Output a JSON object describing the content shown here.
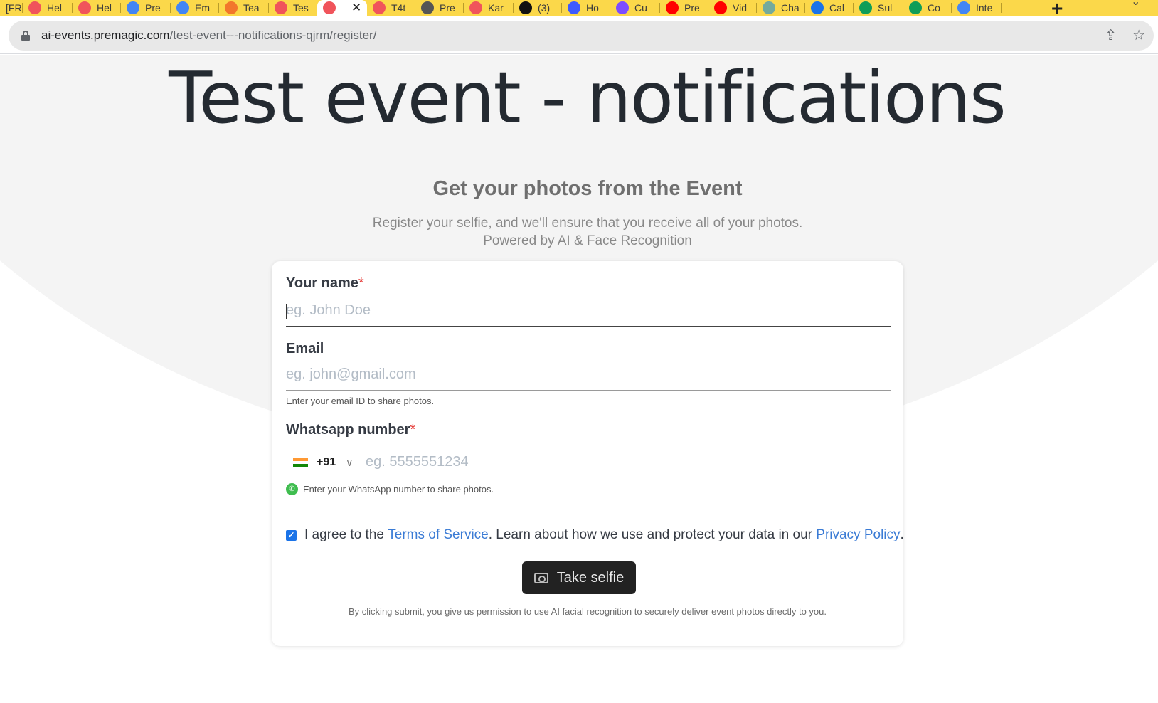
{
  "browser": {
    "tabs": [
      {
        "label": "[FR",
        "favicon": "generic",
        "color": "#fbd84a"
      },
      {
        "label": "Hel",
        "favicon": "premagic-icon",
        "color": "#f0545b"
      },
      {
        "label": "Hel",
        "favicon": "premagic-icon",
        "color": "#f0545b"
      },
      {
        "label": "Pre",
        "favicon": "calendar-icon",
        "color": "#4285f4"
      },
      {
        "label": "Em",
        "favicon": "docs-icon",
        "color": "#4285f4"
      },
      {
        "label": "Tea",
        "favicon": "orange-circle-icon",
        "color": "#f2772c"
      },
      {
        "label": "Tes",
        "favicon": "premagic-icon",
        "color": "#f0545b"
      },
      {
        "label": "",
        "favicon": "premagic-icon",
        "color": "#f0545b",
        "active": true
      },
      {
        "label": "T4t",
        "favicon": "premagic-icon",
        "color": "#f0545b"
      },
      {
        "label": "Pre",
        "favicon": "globe-icon",
        "color": "#555555"
      },
      {
        "label": "Kar",
        "favicon": "premagic-icon",
        "color": "#f0545b"
      },
      {
        "label": "(3)",
        "favicon": "notion-icon",
        "color": "#111111"
      },
      {
        "label": "Ho",
        "favicon": "c-icon",
        "color": "#3d5afe"
      },
      {
        "label": "Cu",
        "favicon": "flower-icon",
        "color": "#7c4dff"
      },
      {
        "label": "Pre",
        "favicon": "youtube-icon",
        "color": "#ff0000"
      },
      {
        "label": "Vid",
        "favicon": "youtube-icon",
        "color": "#ff0000"
      },
      {
        "label": "Cha",
        "favicon": "chatgpt-icon",
        "color": "#74aa9c"
      },
      {
        "label": "Cal",
        "favicon": "o-icon",
        "color": "#1a73e8"
      },
      {
        "label": "Sul",
        "favicon": "sheets-icon",
        "color": "#0f9d58"
      },
      {
        "label": "Co",
        "favicon": "sheets-icon",
        "color": "#0f9d58"
      },
      {
        "label": "Inte",
        "favicon": "google-icon",
        "color": "#4285f4"
      }
    ],
    "url_domain": "ai-events.premagic.com",
    "url_path": "/test-event---notifications-qjrm/register/"
  },
  "page": {
    "title": "Test event - notifications",
    "subtitle": "Get your photos from the Event",
    "description_line1": "Register your selfie, and we'll ensure that you receive all of your photos.",
    "description_line2": "Powered by AI & Face Recognition"
  },
  "form": {
    "name_label": "Your name",
    "name_required": "*",
    "name_placeholder": "eg. John Doe",
    "email_label": "Email",
    "email_placeholder": "eg. john@gmail.com",
    "email_helper": "Enter your email ID to share photos.",
    "whatsapp_label": "Whatsapp number",
    "whatsapp_required": "*",
    "country_code": "+91",
    "phone_placeholder": "eg. 5555551234",
    "whatsapp_helper": "Enter your WhatsApp number to share photos.",
    "agree_prefix": "I agree to the ",
    "terms_link": "Terms of Service",
    "agree_middle": ". Learn about how we use and protect your data in our ",
    "privacy_link": "Privacy Policy",
    "agree_suffix": ".",
    "agree_checked": true,
    "submit_label": "Take selfie",
    "consent_text": "By clicking submit, you give us permission to use AI facial recognition to securely deliver event photos directly to you."
  },
  "colors": {
    "tab_strip": "#fbd84a",
    "link": "#3a7bd5",
    "button": "#222222",
    "required": "#e53935"
  }
}
